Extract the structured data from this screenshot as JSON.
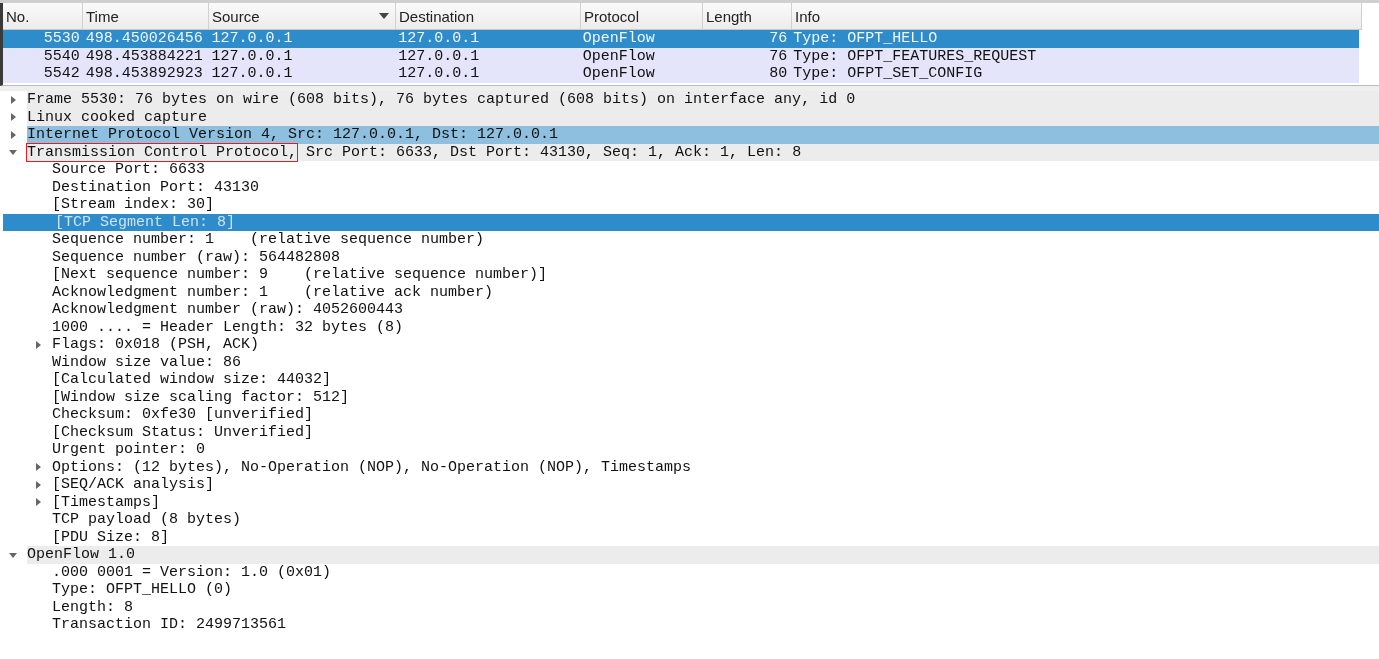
{
  "packet_list": {
    "columns": [
      {
        "label": "No.",
        "kind": "number"
      },
      {
        "label": "Time",
        "kind": "text"
      },
      {
        "label": "Source",
        "kind": "text",
        "sorted": true
      },
      {
        "label": "Destination",
        "kind": "text"
      },
      {
        "label": "Protocol",
        "kind": "text"
      },
      {
        "label": "Length",
        "kind": "number"
      },
      {
        "label": "Info",
        "kind": "text"
      }
    ],
    "rows": [
      {
        "selected": true,
        "cells": [
          "5530",
          "498.450026456",
          "127.0.0.1",
          "127.0.0.1",
          "OpenFlow",
          "76",
          "Type: OFPT_HELLO"
        ]
      },
      {
        "selected": false,
        "cells": [
          "5540",
          "498.453884221",
          "127.0.0.1",
          "127.0.0.1",
          "OpenFlow",
          "76",
          "Type: OFPT_FEATURES_REQUEST"
        ]
      },
      {
        "selected": false,
        "cells": [
          "5542",
          "498.453892923",
          "127.0.0.1",
          "127.0.0.1",
          "OpenFlow",
          "80",
          "Type: OFPT_SET_CONFIG"
        ]
      }
    ]
  },
  "details_tree": [
    {
      "text": "Frame 5530: 76 bytes on wire (608 bits), 76 bytes captured (608 bits) on interface any, id 0",
      "expanded": false,
      "selected": false,
      "highlighted": false
    },
    {
      "text": "Linux cooked capture",
      "expanded": false,
      "selected": false,
      "highlighted": false
    },
    {
      "text": "Internet Protocol Version 4, Src: 127.0.0.1, Dst: 127.0.0.1",
      "expanded": false,
      "selected": false,
      "highlighted": true
    },
    {
      "boxed_text": "Transmission Control Protocol,",
      "text": "Src Port: 6633, Dst Port: 43130, Seq: 1, Ack: 1, Len: 8",
      "expanded": true,
      "selected": false,
      "highlighted": false,
      "children": [
        {
          "text": "Source Port: 6633",
          "selected": false
        },
        {
          "text": "Destination Port: 43130",
          "selected": false
        },
        {
          "text": "[Stream index: 30]",
          "selected": false
        },
        {
          "text": "[TCP Segment Len: 8]",
          "selected": true
        },
        {
          "text": "Sequence number: 1    (relative sequence number)",
          "selected": false
        },
        {
          "text": "Sequence number (raw): 564482808",
          "selected": false
        },
        {
          "text": "[Next sequence number: 9    (relative sequence number)]",
          "selected": false
        },
        {
          "text": "Acknowledgment number: 1    (relative ack number)",
          "selected": false
        },
        {
          "text": "Acknowledgment number (raw): 4052600443",
          "selected": false
        },
        {
          "text": "1000 .... = Header Length: 32 bytes (8)",
          "selected": false
        },
        {
          "text": "Flags: 0x018 (PSH, ACK)",
          "expanded": false,
          "selected": false
        },
        {
          "text": "Window size value: 86",
          "selected": false
        },
        {
          "text": "[Calculated window size: 44032]",
          "selected": false
        },
        {
          "text": "[Window size scaling factor: 512]",
          "selected": false
        },
        {
          "text": "Checksum: 0xfe30 [unverified]",
          "selected": false
        },
        {
          "text": "[Checksum Status: Unverified]",
          "selected": false
        },
        {
          "text": "Urgent pointer: 0",
          "selected": false
        },
        {
          "text": "Options: (12 bytes), No-Operation (NOP), No-Operation (NOP), Timestamps",
          "expanded": false,
          "selected": false
        },
        {
          "text": "[SEQ/ACK analysis]",
          "expanded": false,
          "selected": false
        },
        {
          "text": "[Timestamps]",
          "expanded": false,
          "selected": false
        },
        {
          "text": "TCP payload (8 bytes)",
          "selected": false
        },
        {
          "text": "[PDU Size: 8]",
          "selected": false
        }
      ]
    },
    {
      "text": "OpenFlow 1.0",
      "expanded": true,
      "selected": false,
      "highlighted": false,
      "children": [
        {
          "text": ".000 0001 = Version: 1.0 (0x01)",
          "selected": false
        },
        {
          "text": "Type: OFPT_HELLO (0)",
          "selected": false
        },
        {
          "text": "Length: 8",
          "selected": false
        },
        {
          "text": "Transaction ID: 2499713561",
          "selected": false
        }
      ]
    }
  ]
}
